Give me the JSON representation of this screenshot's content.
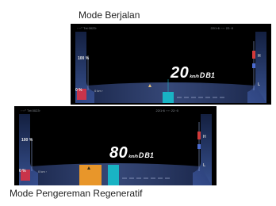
{
  "captions": {
    "top": "Mode Berjalan",
    "bottom": "Mode Pengereman Regeneratif"
  },
  "clusters": [
    {
      "status_left": "◦ ◦◦°  Txt 0023◦",
      "status_right": "22/1◦6 ◦◦◦◦ 22:◦0",
      "battery_label": "100 %",
      "battery_low_label": "0 %",
      "range_text": "0 km ◦",
      "right_top_letter": "H",
      "right_bottom_letter": "L",
      "speed": "20",
      "unit": "km/h",
      "gear": "D",
      "gear_step": "B1",
      "mode": "driving"
    },
    {
      "status_left": "◦ ◦◦°  Txt 0023◦",
      "status_right": "22/1◦6 ◦◦◦◦ 22:◦0",
      "battery_label": "100 %",
      "battery_low_label": "0 %",
      "range_text": "0 km ◦",
      "right_top_letter": "H",
      "right_bottom_letter": "L",
      "speed": "80",
      "unit": "km/h",
      "gear": "D",
      "gear_step": "B1",
      "mode": "regen"
    }
  ],
  "colors": {
    "frame_blue": "#3a5aa8",
    "accent_cyan": "#19b3c4",
    "regen_orange": "#e8962a",
    "battery_red": "#c9344a"
  }
}
